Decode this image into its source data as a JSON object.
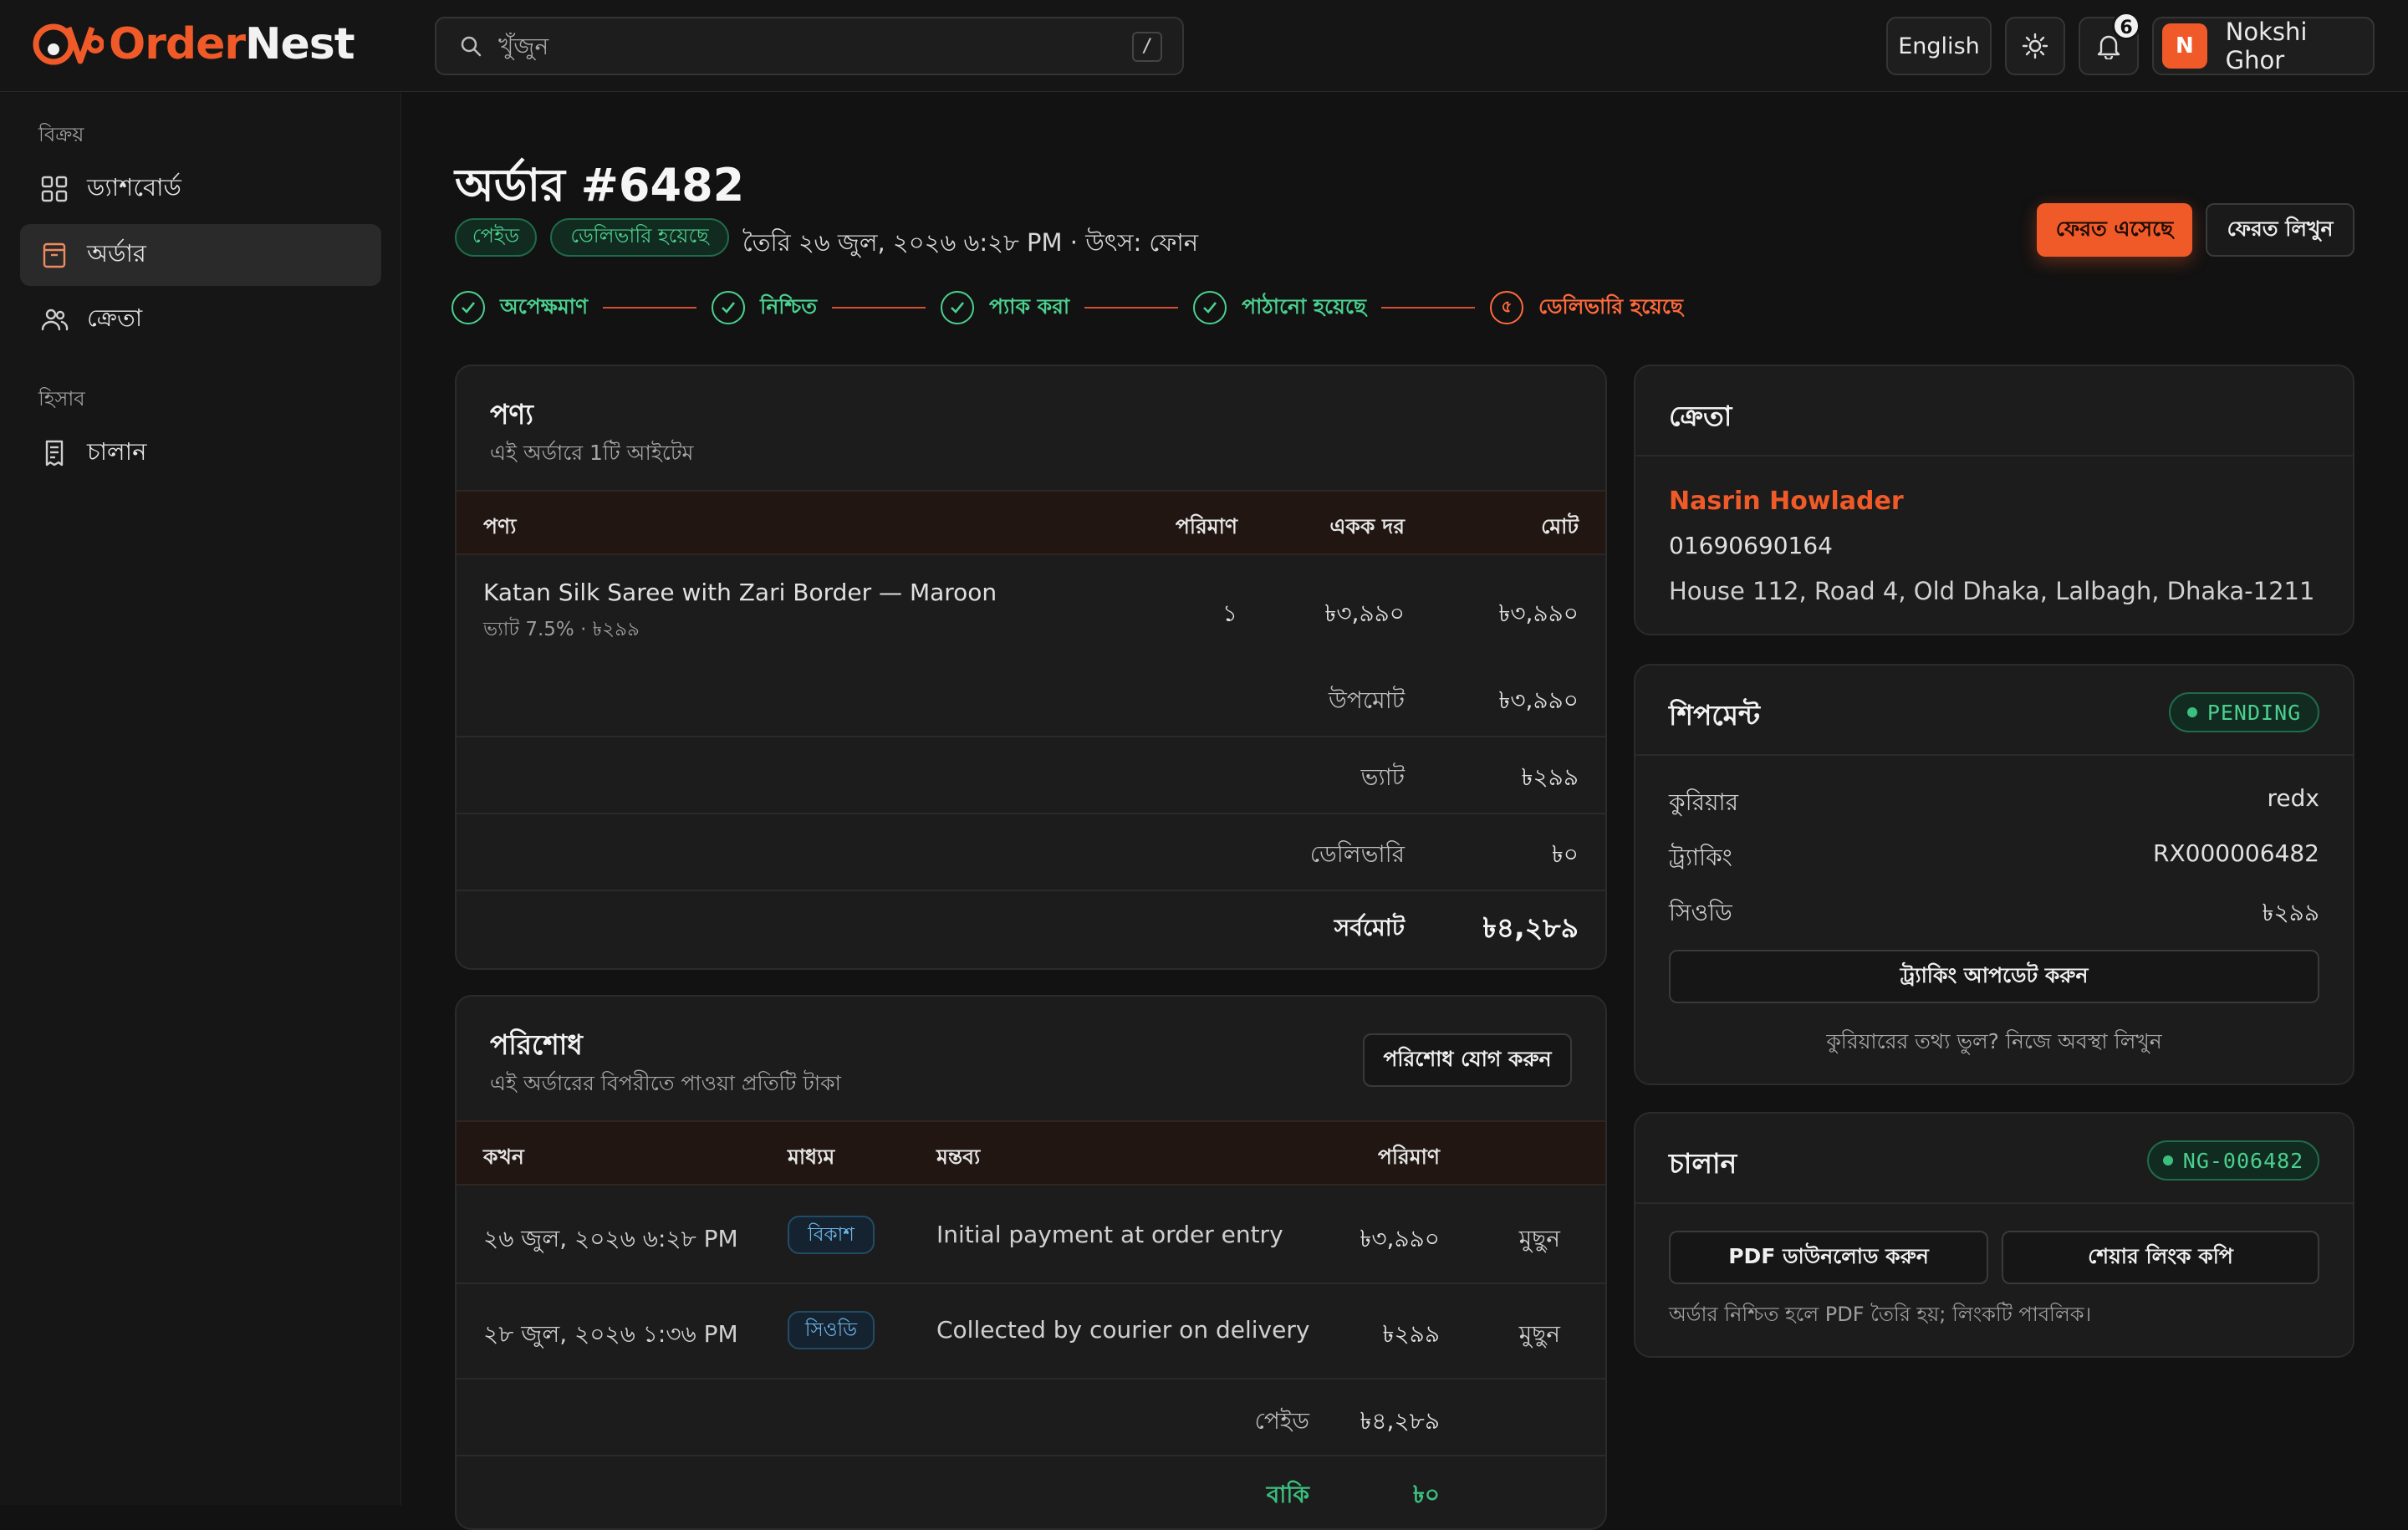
{
  "brand": {
    "name_a": "Order",
    "name_b": "Nest"
  },
  "search": {
    "placeholder": "খুঁজুন",
    "shortcut": "/"
  },
  "header": {
    "language": "English",
    "notif_count": "6",
    "user_initial": "N",
    "user_name": "Nokshi Ghor"
  },
  "sidebar": {
    "sections": [
      {
        "label": "বিক্রয়",
        "items": [
          {
            "label": "ড্যাশবোর্ড",
            "icon": "grid-icon"
          },
          {
            "label": "অর্ডার",
            "icon": "box-icon",
            "active": true
          },
          {
            "label": "ক্রেতা",
            "icon": "users-icon"
          }
        ]
      },
      {
        "label": "হিসাব",
        "items": [
          {
            "label": "চালান",
            "icon": "receipt-icon"
          }
        ]
      }
    ]
  },
  "order": {
    "title": "অর্ডার #6482",
    "status_paid": "পেইড",
    "status_delivered": "ডেলিভারি হয়েছে",
    "meta": "তৈরি ২৬ জুল, ২০২৬ ৬:২৮ PM · উৎস: ফোন",
    "btn_returned": "ফেরত এসেছে",
    "btn_write_return": "ফেরত লিখুন"
  },
  "steps": [
    {
      "label": "অপেক্ষমাণ",
      "done": true
    },
    {
      "label": "নিশ্চিত",
      "done": true
    },
    {
      "label": "প্যাক করা",
      "done": true
    },
    {
      "label": "পাঠানো হয়েছে",
      "done": true
    },
    {
      "label": "ডেলিভারি হয়েছে",
      "num": "৫",
      "current": true
    }
  ],
  "products": {
    "title": "পণ্য",
    "subtitle": "এই অর্ডারে 1টি আইটেম",
    "headers": [
      "পণ্য",
      "পরিমাণ",
      "একক দর",
      "মোট"
    ],
    "rows": [
      {
        "name": "Katan Silk Saree with Zari Border — Maroon",
        "sub": "ভ্যাট 7.5% · ৳২৯৯",
        "qty": "১",
        "unit": "৳৩,৯৯০",
        "total": "৳৩,৯৯০"
      }
    ],
    "summary": [
      {
        "label": "উপমোট",
        "value": "৳৩,৯৯০"
      },
      {
        "label": "ভ্যাট",
        "value": "৳২৯৯"
      },
      {
        "label": "ডেলিভারি",
        "value": "৳০"
      },
      {
        "label": "সর্বমোট",
        "value": "৳৪,২৮৯"
      }
    ]
  },
  "payments": {
    "title": "পরিশোধ",
    "subtitle": "এই অর্ডারের বিপরীতে পাওয়া প্রতিটি টাকা",
    "add_button": "পরিশোধ যোগ করুন",
    "headers": [
      "কখন",
      "মাধ্যম",
      "মন্তব্য",
      "পরিমাণ"
    ],
    "rows": [
      {
        "when": "২৬ জুল, ২০২৬ ৬:২৮ PM",
        "method": "বিকাশ",
        "note": "Initial payment at order entry",
        "amount": "৳৩,৯৯০",
        "action": "মুছুন"
      },
      {
        "when": "২৮ জুল, ২০২৬ ১:৩৬ PM",
        "method": "সিওডি",
        "note": "Collected by courier on delivery",
        "amount": "৳২৯৯",
        "action": "মুছুন"
      }
    ],
    "paid_label": "পেইড",
    "paid_value": "৳৪,২৮৯",
    "due_label": "বাকি",
    "due_value": "৳০"
  },
  "customer": {
    "title": "ক্রেতা",
    "name": "Nasrin Howlader",
    "phone": "01690690164",
    "address": "House 112, Road 4, Old Dhaka, Lalbagh, Dhaka-1211"
  },
  "shipment": {
    "title": "শিপমেন্ট",
    "status": "PENDING",
    "rows": [
      {
        "label": "কুরিয়ার",
        "value": "redx"
      },
      {
        "label": "ট্র্যাকিং",
        "value": "RX000006482"
      },
      {
        "label": "সিওডি",
        "value": "৳২৯৯"
      }
    ],
    "update_button": "ট্র্যাকিং আপডেট করুন",
    "note": "কুরিয়ারের তথ্য ভুল? নিজে অবস্থা লিখুন"
  },
  "invoice": {
    "title": "চালান",
    "number": "NG-006482",
    "download_button": "PDF ডাউনলোড করুন",
    "share_button": "শেয়ার লিংক কপি",
    "note": "অর্ডার নিশ্চিত হলে PDF তৈরি হয়; লিংকটি পাবলিক।"
  },
  "colors": {
    "accent": "#f05a28",
    "success": "#4bd08f",
    "info": "#6fb4ea"
  }
}
